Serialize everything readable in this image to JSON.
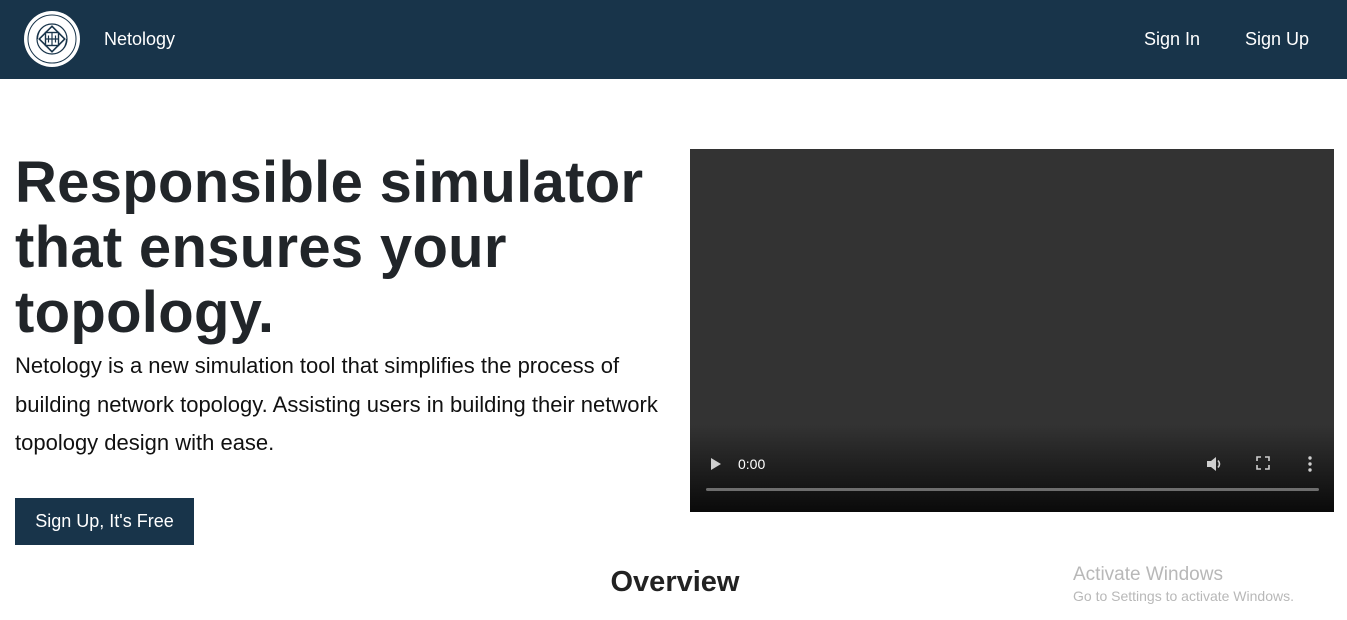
{
  "navbar": {
    "logo_icon": "netology-simulator-logo",
    "logo_text_top": "NETOLOGY",
    "logo_text_bottom": "SIMULATOR",
    "brand": "Netology",
    "sign_in": "Sign In",
    "sign_up": "Sign Up",
    "background": "#18344a"
  },
  "hero": {
    "title": "Responsible simulator that ensures your topology.",
    "description": "Netology is a new simulation tool that simplifies the process of building network topology. Assisting users in building their network topology design with ease.",
    "cta": "Sign Up, It's Free"
  },
  "video": {
    "time": "0:00",
    "progress": 0,
    "controls": [
      "play-icon",
      "volume-icon",
      "fullscreen-icon",
      "more-options-icon"
    ]
  },
  "overview": {
    "heading": "Overview"
  },
  "watermark": {
    "title": "Activate Windows",
    "subtitle": "Go to Settings to activate Windows."
  }
}
